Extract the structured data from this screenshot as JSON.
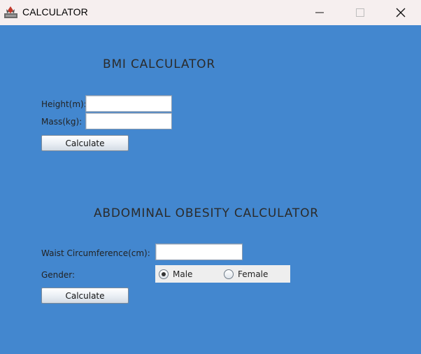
{
  "window": {
    "title": "CALCULATOR",
    "controls": [
      "minimize-icon",
      "maximize-icon",
      "close-icon"
    ]
  },
  "bmi": {
    "title": "BMI CALCULATOR",
    "height_label": "Height(m):",
    "height_value": "",
    "mass_label": "Mass(kg):",
    "mass_value": "",
    "calculate_label": "Calculate"
  },
  "obesity": {
    "title": "ABDOMINAL OBESITY CALCULATOR",
    "waist_label": "Waist Circumference(cm):",
    "waist_value": "",
    "gender_label": "Gender:",
    "gender_options": [
      "Male",
      "Female"
    ],
    "gender_selected": "Male",
    "calculate_label": "Calculate"
  },
  "colors": {
    "background": "#4387cf",
    "titlebar": "#f6efef"
  }
}
